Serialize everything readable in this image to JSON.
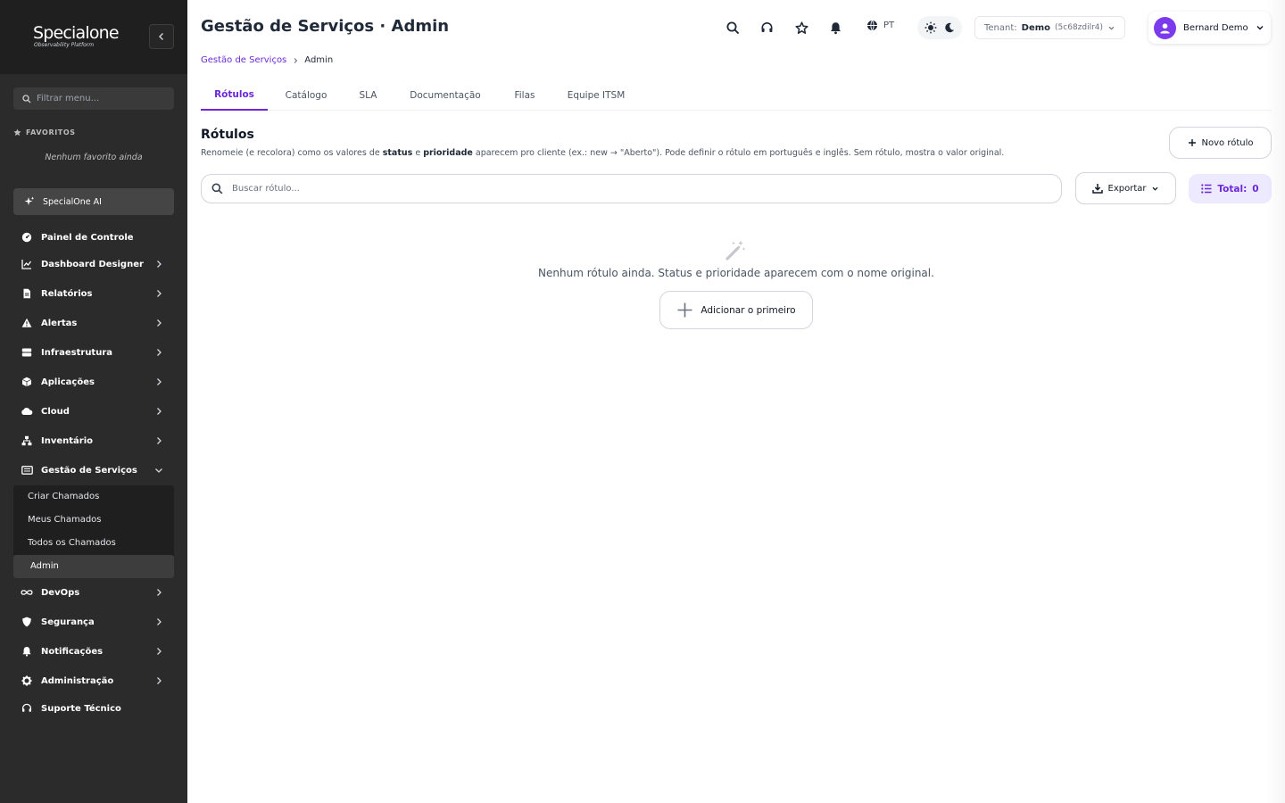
{
  "brand": {
    "name": "Specialone",
    "tagline": "Observability Platform"
  },
  "sidebar": {
    "filter_placeholder": "Filtrar menu...",
    "favorites_title": "FAVORITOS",
    "favorites_empty": "Nenhum favorito ainda",
    "ai_label": "SpecialOne AI",
    "items": [
      {
        "label": "Painel de Controle",
        "icon": "dashboard-icon",
        "has_children": false
      },
      {
        "label": "Dashboard Designer",
        "icon": "chart-line-icon",
        "has_children": true
      },
      {
        "label": "Relatórios",
        "icon": "file-icon",
        "has_children": true
      },
      {
        "label": "Alertas",
        "icon": "warning-icon",
        "has_children": true
      },
      {
        "label": "Infraestrutura",
        "icon": "server-icon",
        "has_children": true
      },
      {
        "label": "Aplicações",
        "icon": "cube-icon",
        "has_children": true
      },
      {
        "label": "Cloud",
        "icon": "cloud-icon",
        "has_children": true
      },
      {
        "label": "Inventário",
        "icon": "sitemap-icon",
        "has_children": true
      },
      {
        "label": "Gestão de Serviços",
        "icon": "ticket-icon",
        "has_children": true,
        "expanded": true
      },
      {
        "label": "DevOps",
        "icon": "infinity-icon",
        "has_children": true
      },
      {
        "label": "Segurança",
        "icon": "shield-icon",
        "has_children": true
      },
      {
        "label": "Notificações",
        "icon": "bell-icon",
        "has_children": true
      },
      {
        "label": "Administração",
        "icon": "gear-icon",
        "has_children": true
      },
      {
        "label": "Suporte Técnico",
        "icon": "headset-icon",
        "has_children": false
      }
    ],
    "sub_items": [
      {
        "label": "Criar Chamados"
      },
      {
        "label": "Meus Chamados"
      },
      {
        "label": "Todos os Chamados"
      },
      {
        "label": "Admin",
        "active": true
      }
    ]
  },
  "header": {
    "title": "Gestão de Serviços · Admin",
    "language": "PT",
    "tenant_label": "Tenant:",
    "tenant_name": "Demo",
    "tenant_id": "(5c68zdilr4)",
    "user_name": "Bernard Demo"
  },
  "breadcrumb": {
    "parent": "Gestão de Serviços",
    "current": "Admin"
  },
  "tabs": [
    {
      "label": "Rótulos",
      "active": true
    },
    {
      "label": "Catálogo"
    },
    {
      "label": "SLA"
    },
    {
      "label": "Documentação"
    },
    {
      "label": "Filas"
    },
    {
      "label": "Equipe ITSM"
    }
  ],
  "section": {
    "title": "Rótulos",
    "desc_1": "Renomeie (e recolora) como os valores de ",
    "desc_status": "status",
    "desc_2": " e ",
    "desc_priority": "prioridade",
    "desc_3": " aparecem pro cliente (ex.: new → \"Aberto\"). Pode definir o rótulo em português e inglês. Sem rótulo, mostra o valor original.",
    "new_button": "Novo rótulo",
    "search_placeholder": "Buscar rótulo...",
    "export_label": "Exportar",
    "total_label": "Total:",
    "total_value": "0",
    "empty_message": "Nenhum rótulo ainda. Status e prioridade aparecem com o nome original.",
    "add_first_label": "Adicionar o primeiro"
  },
  "colors": {
    "accent": "#6d28d9",
    "sidebar_bg": "#2b2b2b",
    "sidebar_head_bg": "#1f1f1f"
  }
}
